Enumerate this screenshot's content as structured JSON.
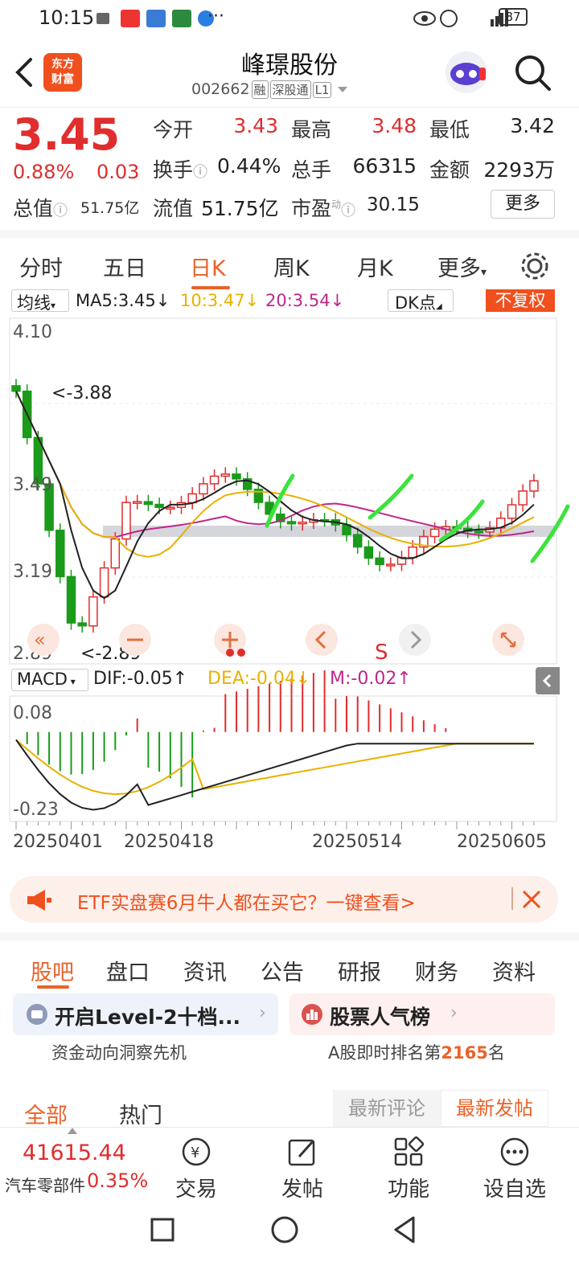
{
  "status_bar": {
    "time": "10:15",
    "battery": "87",
    "more": "···"
  },
  "header": {
    "logo_line1": "东方",
    "logo_line2": "财富",
    "title": "峰璟股份",
    "code": "002662",
    "tags": [
      "融",
      "深股通",
      "L1"
    ]
  },
  "quote": {
    "price": "3.45",
    "change_pct": "0.88%",
    "change": "0.03",
    "fields": [
      {
        "label": "今开",
        "value": "3.43",
        "color": "red"
      },
      {
        "label": "最高",
        "value": "3.48",
        "color": "red"
      },
      {
        "label": "最低",
        "value": "3.42",
        "color": "black"
      },
      {
        "label": "换手",
        "value": "0.44%",
        "color": "black"
      },
      {
        "label": "总手",
        "value": "66315",
        "color": "black"
      },
      {
        "label": "金额",
        "value": "2293万",
        "color": "black"
      }
    ],
    "total_value_label": "总值",
    "total_value": "51.75亿",
    "float_label": "流值",
    "float_value": "51.75亿",
    "pe_label": "市盈",
    "pe_sup": "动",
    "pe_value": "30.15",
    "more_button": "更多"
  },
  "period_tabs": [
    "分时",
    "五日",
    "日K",
    "周K",
    "月K",
    "更多"
  ],
  "active_period": "日K",
  "ma_bar": {
    "selector": "均线",
    "ma5": "MA5:3.45",
    "ma10": "10:3.47",
    "ma20": "20:3.54",
    "dk": "DK点",
    "adjust": "不复权"
  },
  "kline": {
    "y_ticks": [
      "4.10",
      "3.49",
      "3.19",
      "2.89"
    ],
    "high_marker": "3.88",
    "low_marker": "<-2.89",
    "sell_mark": "S"
  },
  "macd_bar": {
    "selector": "MACD",
    "dif": "DIF:-0.05",
    "dea": "DEA:-0.04",
    "m": "M:-0.02"
  },
  "macd": {
    "y_ticks": [
      "0.08",
      "-0.23"
    ]
  },
  "x_dates": [
    "20250401",
    "20250418",
    "20250514",
    "20250605"
  ],
  "chart_data": {
    "type": "candlestick",
    "x": [
      "20250401",
      "20250418",
      "20250514",
      "20250605"
    ],
    "ylim": [
      2.89,
      4.1
    ],
    "last": {
      "open": 3.43,
      "high": 3.48,
      "low": 3.42,
      "close": 3.45
    },
    "ma": {
      "MA5": 3.45,
      "MA10": 3.47,
      "MA20": 3.54
    },
    "macd": {
      "DIF": -0.05,
      "DEA": -0.04,
      "M": -0.02,
      "ylim": [
        -0.23,
        0.08
      ]
    }
  },
  "banner": {
    "text": "ETF实盘赛6月牛人都在买它？一键查看>"
  },
  "content_tabs": [
    "股吧",
    "盘口",
    "资讯",
    "公告",
    "研报",
    "财务",
    "资料"
  ],
  "cards": [
    {
      "title": "开启Level-2十档...",
      "subtitle": "资金动向洞察先机"
    },
    {
      "title": "股票人气榜",
      "subtitle_prefix": "A股即时排名第",
      "rank": "2165",
      "subtitle_suffix": "名"
    }
  ],
  "post_tabs": {
    "all": "全部",
    "hot": "热门",
    "latest_comment": "最新评论",
    "latest_post": "最新发帖"
  },
  "bottom_bar": {
    "index_value": "41615.44",
    "index_name": "汽车零部件",
    "index_change": "0.35%",
    "items": [
      "交易",
      "发帖",
      "功能",
      "设自选"
    ]
  }
}
